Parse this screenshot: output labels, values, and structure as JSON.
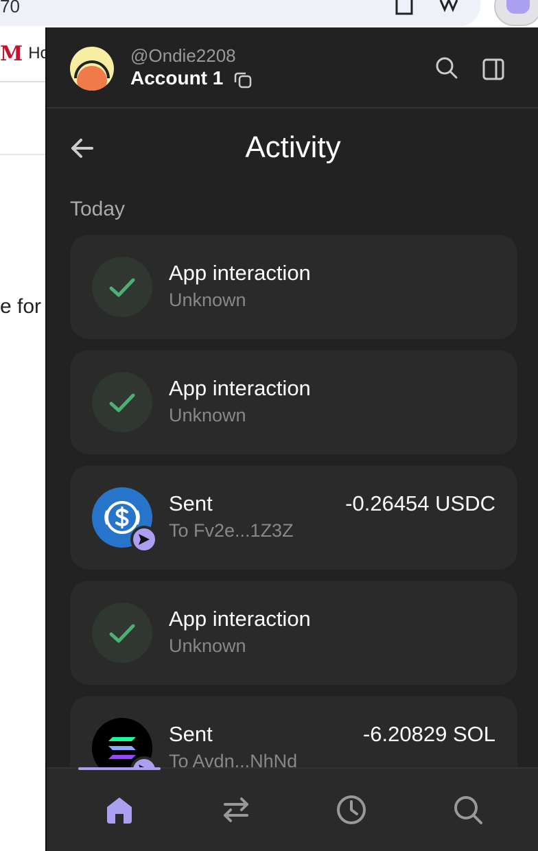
{
  "browser": {
    "url_fragment": "70",
    "tab_label": "Ho",
    "page_partial_text": "e for"
  },
  "header": {
    "username": "@Ondie2208",
    "account_name": "Account 1"
  },
  "page": {
    "title": "Activity",
    "section_label": "Today"
  },
  "activity": [
    {
      "title": "App interaction",
      "subtitle": "Unknown",
      "amount": "",
      "icon": "check-icon"
    },
    {
      "title": "App interaction",
      "subtitle": "Unknown",
      "amount": "",
      "icon": "check-icon"
    },
    {
      "title": "Sent",
      "subtitle": "To Fv2e...1Z3Z",
      "amount": "-0.26454 USDC",
      "icon": "usdc-icon"
    },
    {
      "title": "App interaction",
      "subtitle": "Unknown",
      "amount": "",
      "icon": "check-icon"
    },
    {
      "title": "Sent",
      "subtitle": "To Avdn...NhNd",
      "amount": "-6.20829 SOL",
      "icon": "sol-icon"
    }
  ],
  "nav": {
    "items": [
      "home-icon",
      "swap-icon",
      "history-icon",
      "search-icon"
    ],
    "active": "home-icon"
  },
  "colors": {
    "accent": "#ab9ff2",
    "success": "#4caf74",
    "usdc": "#2775ca",
    "panel_bg": "#222222",
    "card_bg": "#2a2a2a"
  }
}
